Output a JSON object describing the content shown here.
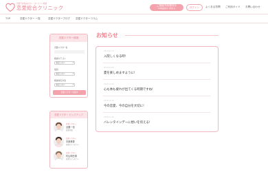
{
  "header": {
    "logo_tagline": "恋愛でお悩みの方へ｜オンライン相談",
    "logo_text": "恋愛総合クリニック",
    "reserve": {
      "line1": "ご相談予約受付中",
      "line2": "24時間受付中 予約する"
    },
    "login": "ログイン",
    "links": [
      "よくある質問",
      "ご利用ガイド",
      "お問い合わせ"
    ]
  },
  "nav": {
    "items": [
      "TOP",
      "恋愛ドクター 一覧",
      "恋愛ドクターブログ",
      "恋愛ドクターコラム"
    ]
  },
  "sidebar": {
    "search": {
      "title": "恋愛ドクター検索",
      "name_label": "恋愛ドクター名",
      "name_value": "",
      "category_label": "相談カテゴリ",
      "category_value": "指定しない",
      "gender_label": "性別",
      "gender_value": "指定しない",
      "method_label": "相談対応方法",
      "method_value": "指定しない",
      "submit": "恋愛ドクターを探す"
    },
    "pickup": {
      "title": "恋愛ドクター ピックアップ",
      "items": [
        {
          "tag": "恋愛ドクター",
          "name": "近藤一也",
          "role": "恋愛全般"
        },
        {
          "tag": "恋愛ドクター",
          "name": "中原美香",
          "role": "恋愛カウンセラー"
        },
        {
          "tag": "恋愛ドクター",
          "name": "村山明日香",
          "role": "恋愛カウンセラー"
        }
      ]
    }
  },
  "main": {
    "heading": "お知らせ",
    "news": [
      {
        "date": "2019.01.15",
        "title": "入院しくなる時!"
      },
      {
        "date": "2019.01.08",
        "title": "夏を楽しめますように!"
      },
      {
        "date": "2018.12.25",
        "title": "心も体も疲れが出てくる時期ですね!"
      },
      {
        "date": "2018.12.12",
        "title": "今の恋愛、今の自分を大切に!"
      },
      {
        "date": "2018.11.30",
        "title": "バレンタインデーに想いを伝える!"
      }
    ]
  },
  "colors": {
    "accent": "#f08590",
    "panel_border": "#f3b7be",
    "panel_head": "#fbe5e8"
  }
}
